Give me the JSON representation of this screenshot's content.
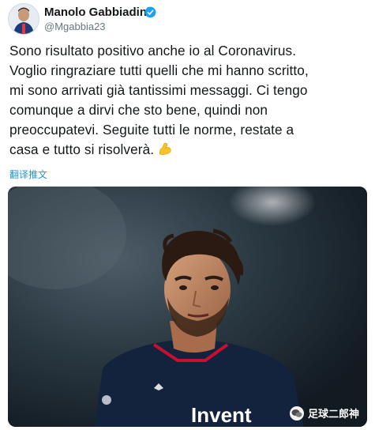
{
  "tweet": {
    "author_name": "Manolo Gabbiadini",
    "handle": "@Mgabbia23",
    "text_lines": [
      "Sono risultato positivo anche io al Coronavirus.",
      "Voglio ringraziare tutti quelli che mi hanno scritto,",
      "mi sono arrivati già tantissimi messaggi. Ci tengo",
      "comunque a dirvi che sto bene, quindi non",
      "preoccupatevi. Seguite tutti le norme, restate a",
      "casa e tutto si risolverà."
    ],
    "emoji": "flexed-biceps-emoji",
    "translate_label": "翻译推文"
  },
  "media": {
    "jersey_text": "Invent",
    "watermark_text": "足球二郎神",
    "watermark_icon": "wechat-icon"
  },
  "colors": {
    "link": "#1b95e0",
    "verified": "#1da1f2",
    "secondary_text": "#657786"
  }
}
